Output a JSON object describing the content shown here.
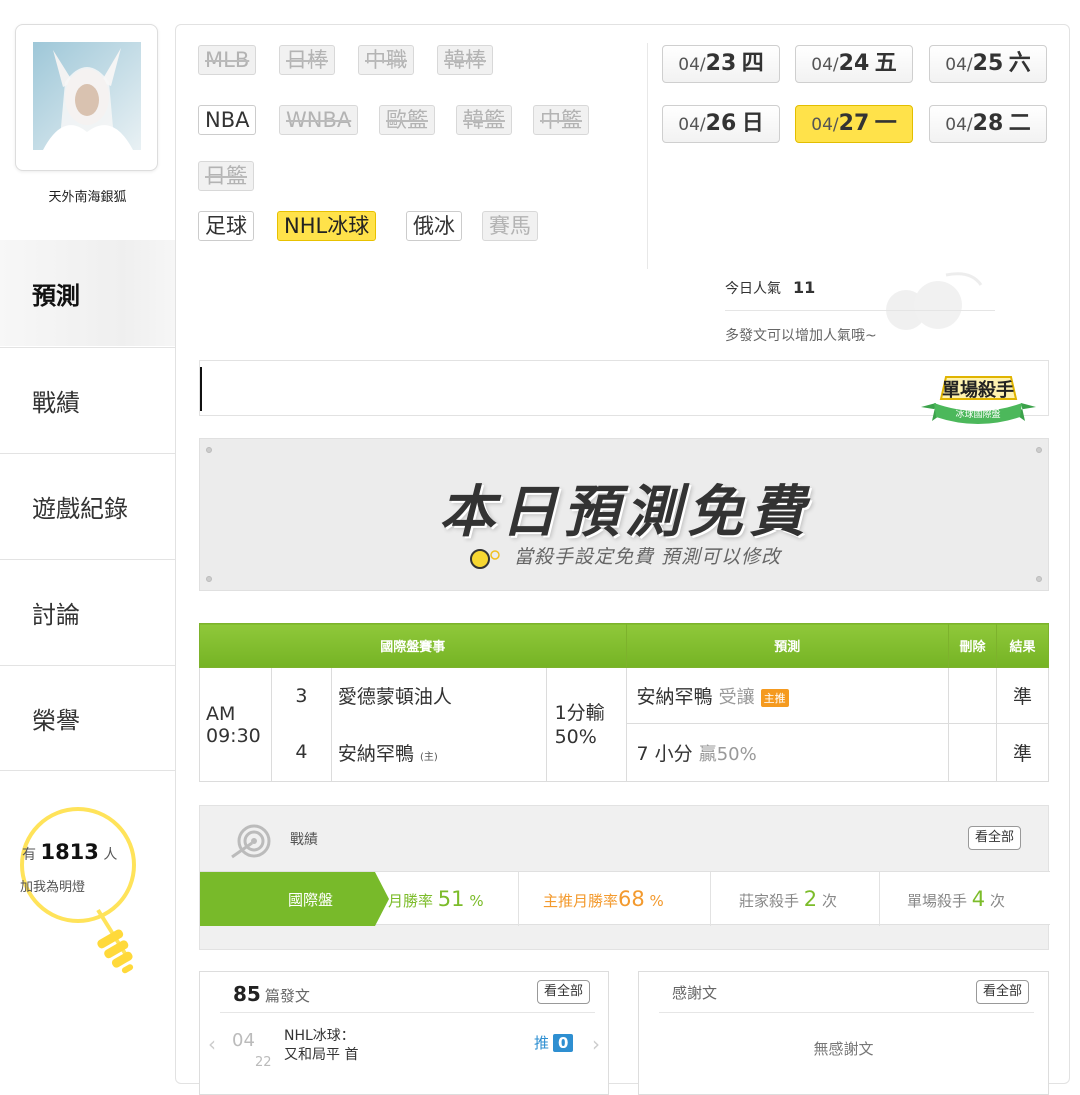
{
  "sidebar": {
    "username": "天外南海銀狐",
    "nav": [
      {
        "label": "預測",
        "active": true
      },
      {
        "label": "戰績",
        "active": false
      },
      {
        "label": "遊戲紀錄",
        "active": false
      },
      {
        "label": "討論",
        "active": false
      },
      {
        "label": "榮譽",
        "active": false
      }
    ],
    "fans": {
      "prefix": "有",
      "count": "1813",
      "suffix": "人",
      "subtitle": "加我為明燈"
    }
  },
  "sports": {
    "row1": [
      "MLB",
      "日棒",
      "中職",
      "韓棒"
    ],
    "row2": [
      "NBA",
      "WNBA",
      "歐籃",
      "韓籃",
      "中籃"
    ],
    "row3": [
      "日籃"
    ],
    "row4": [
      "足球",
      "NHL冰球",
      "俄冰",
      "賽馬"
    ]
  },
  "dates": [
    {
      "month": "04/",
      "day": "23",
      "weekday": "四"
    },
    {
      "month": "04/",
      "day": "24",
      "weekday": "五"
    },
    {
      "month": "04/",
      "day": "25",
      "weekday": "六"
    },
    {
      "month": "04/",
      "day": "26",
      "weekday": "日"
    },
    {
      "month": "04/",
      "day": "27",
      "weekday": "一"
    },
    {
      "month": "04/",
      "day": "28",
      "weekday": "二"
    }
  ],
  "popularity": {
    "label": "今日人氣",
    "value": "11",
    "hint": "多發文可以增加人氣哦~"
  },
  "badge": {
    "title": "單場殺手",
    "subtitle": "冰球國際盤"
  },
  "free_banner": {
    "title": "本日預測免費",
    "subtitle": "當殺手設定免費 預測可以修改"
  },
  "table": {
    "headers": {
      "match": "國際盤賽事",
      "prediction": "預測",
      "delete": "刪除",
      "result": "結果"
    },
    "time": "AM 09:30",
    "away": {
      "num": "3",
      "team": "愛德蒙頓油人"
    },
    "home": {
      "num": "4",
      "team": "安納罕鴨",
      "tag": "(主)"
    },
    "odds": "1分輸 50%",
    "pred1": {
      "main": "安納罕鴨",
      "dim": "受讓",
      "tag": "主推",
      "result": "準"
    },
    "pred2": {
      "main": "7 小分",
      "dim": "贏50%",
      "result": "準"
    }
  },
  "stats": {
    "label": "戰績",
    "view_all": "看全部",
    "tab": "國際盤",
    "monthly_label": "月勝率",
    "monthly_value": "51",
    "monthly_unit": "%",
    "main_label": "主推月勝率",
    "main_value": "68",
    "main_unit": "%",
    "dealer_label": "莊家殺手",
    "dealer_value": "2",
    "dealer_unit": "次",
    "single_label": "單場殺手",
    "single_value": "4",
    "single_unit": "次"
  },
  "posts": {
    "count": "85",
    "label": "篇發文",
    "view_all": "看全部",
    "item": {
      "month": "04",
      "day": "22",
      "title1": "NHL冰球：",
      "title2": "又和局平 首",
      "push_label": "推",
      "push": "0"
    }
  },
  "thanks": {
    "label": "感謝文",
    "view_all": "看全部",
    "empty": "無感謝文"
  }
}
